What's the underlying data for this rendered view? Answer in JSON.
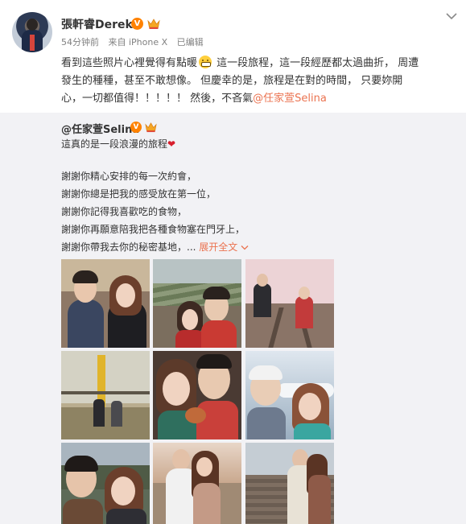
{
  "author": {
    "name": "張軒睿Derek",
    "verified_badge": "V",
    "time": "54分钟前",
    "source": "来自 iPhone X",
    "edited": "已编辑"
  },
  "post": {
    "line1_a": "看到這些照片心裡覺得有點暖",
    "line1_b": "  這一段旅程，這一段經歷都太過曲折，  周遭",
    "line2": "發生的種種，甚至不敢想像。   但慶幸的是，旅程是在對的時間，   只要妳開",
    "line3_a": "心，一切都值得！！！！！   然後，不吝氣",
    "mention": "@任家萱Selina"
  },
  "repost": {
    "author": "@任家萱Selina",
    "verified_badge": "V",
    "line1": "這真的是一段浪漫的旅程",
    "heart": "❤",
    "line2": "謝謝你精心安排的每一次約會，",
    "line3": "謝謝你總是把我的感受放在第一位，",
    "line4": "謝謝你記得我喜歡吃的食物，",
    "line5": "謝謝你再願意陪我把各種食物塞在門牙上，",
    "line6": "謝謝你帶我去你的秘密基地，...",
    "expand": "展开全文"
  },
  "icons": {
    "verified": "verified-v-icon",
    "vip": "crown-icon",
    "menu": "chevron-down-icon",
    "emoji": "grimace-emoji-icon"
  },
  "colors": {
    "accent": "#eb7350",
    "verified": "#ff8200",
    "repost_bg": "#f2f2f5"
  },
  "photos": [
    {
      "name": "photo-couple-cafe"
    },
    {
      "name": "photo-couple-terraces"
    },
    {
      "name": "photo-couple-railway"
    },
    {
      "name": "photo-couple-bridge"
    },
    {
      "name": "photo-couple-food"
    },
    {
      "name": "photo-couple-airport"
    },
    {
      "name": "photo-couple-mountain"
    },
    {
      "name": "photo-couple-sunset"
    },
    {
      "name": "photo-couple-village"
    }
  ]
}
